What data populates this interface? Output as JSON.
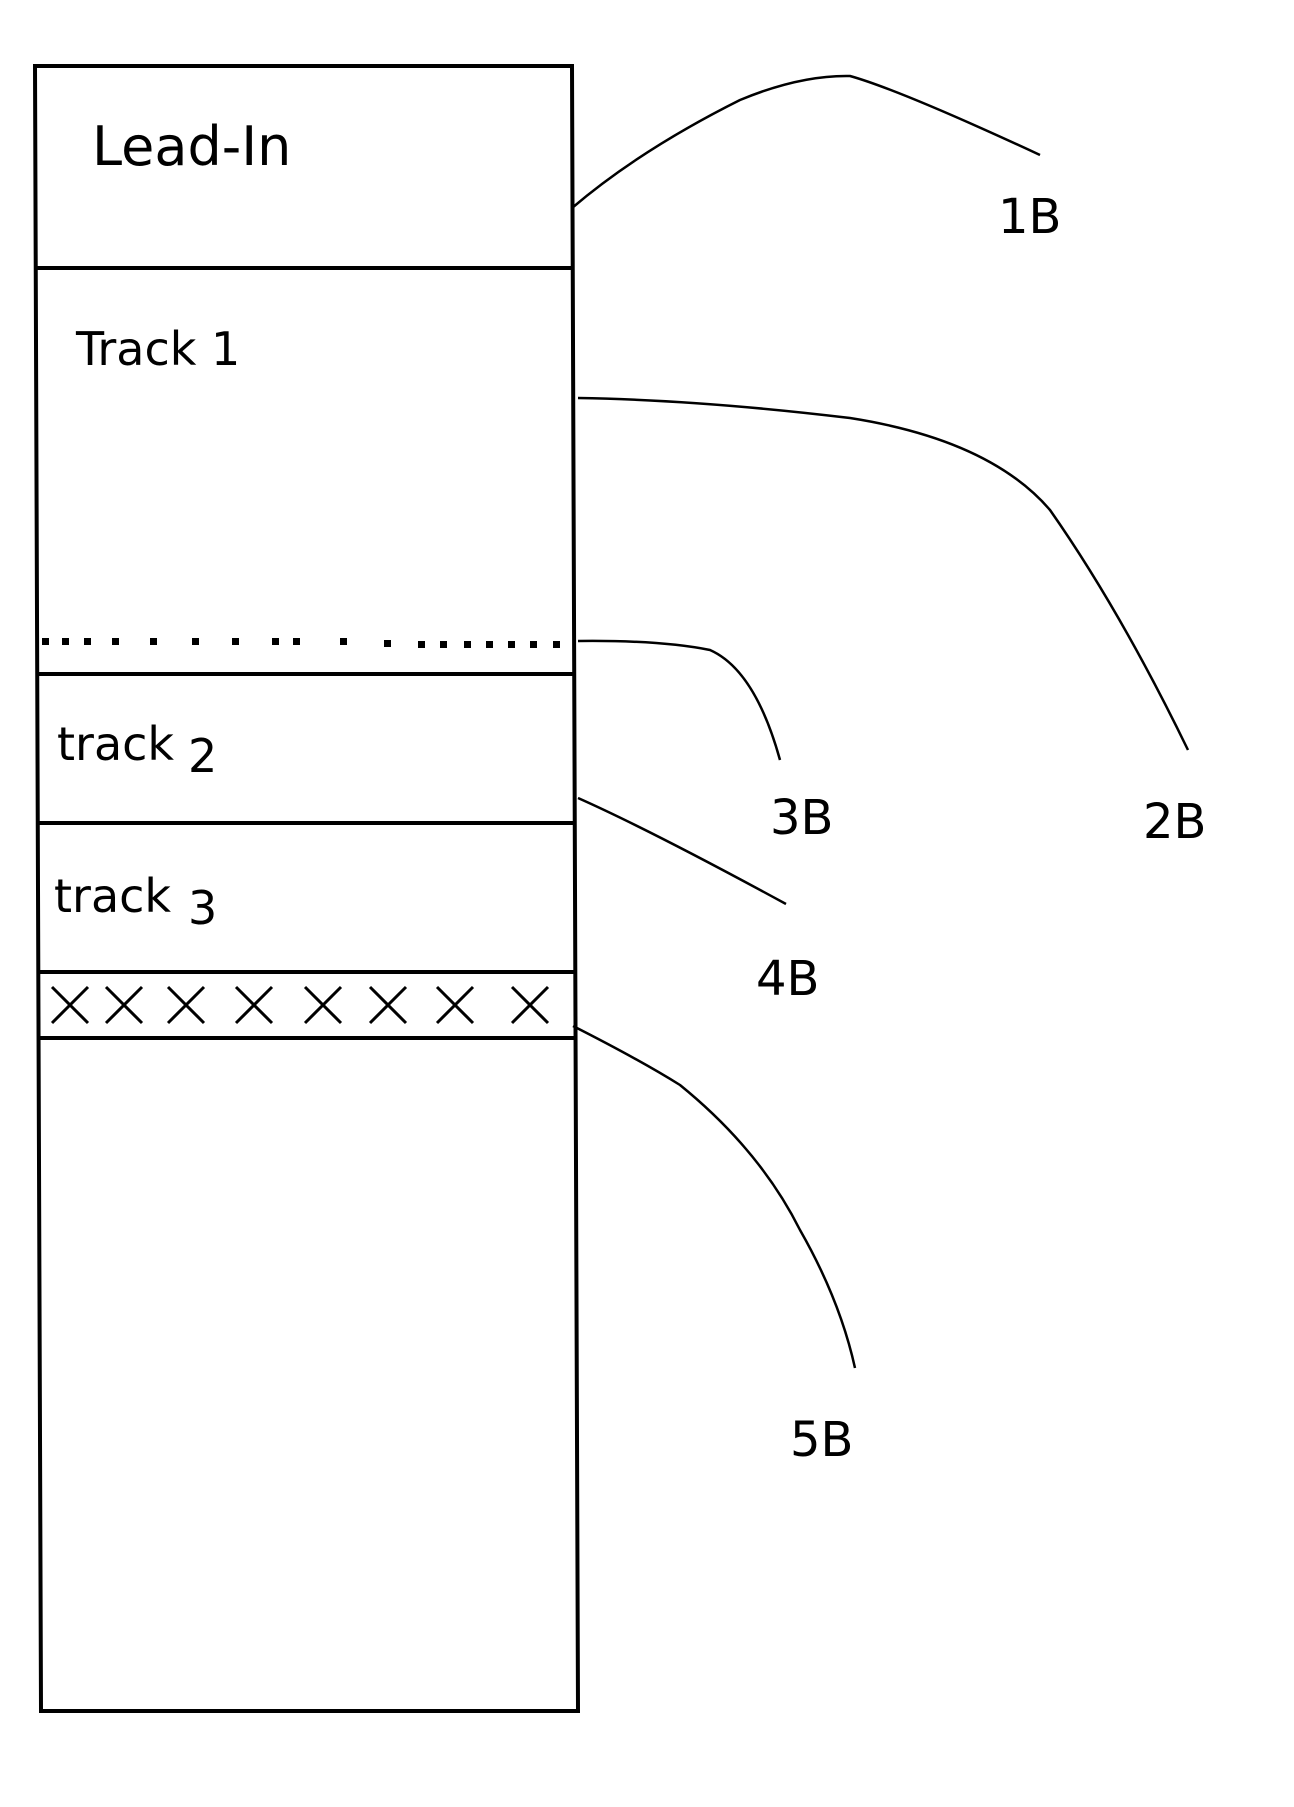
{
  "diagram": {
    "regions": [
      {
        "id": "lead-in",
        "label": "Lead-In"
      },
      {
        "id": "track-1",
        "label": "Track 1"
      },
      {
        "id": "track-2",
        "label_word": "track",
        "label_num": "2"
      },
      {
        "id": "track-3",
        "label_word": "track",
        "label_num": "3"
      },
      {
        "id": "crossed-band",
        "pattern": "xxxxxxxx"
      },
      {
        "id": "empty-area",
        "label": ""
      }
    ],
    "references": [
      {
        "id": "1B",
        "label": "1B"
      },
      {
        "id": "2B",
        "label": "2B"
      },
      {
        "id": "3B",
        "label": "3B"
      },
      {
        "id": "4B",
        "label": "4B"
      },
      {
        "id": "5B",
        "label": "5B"
      }
    ]
  }
}
